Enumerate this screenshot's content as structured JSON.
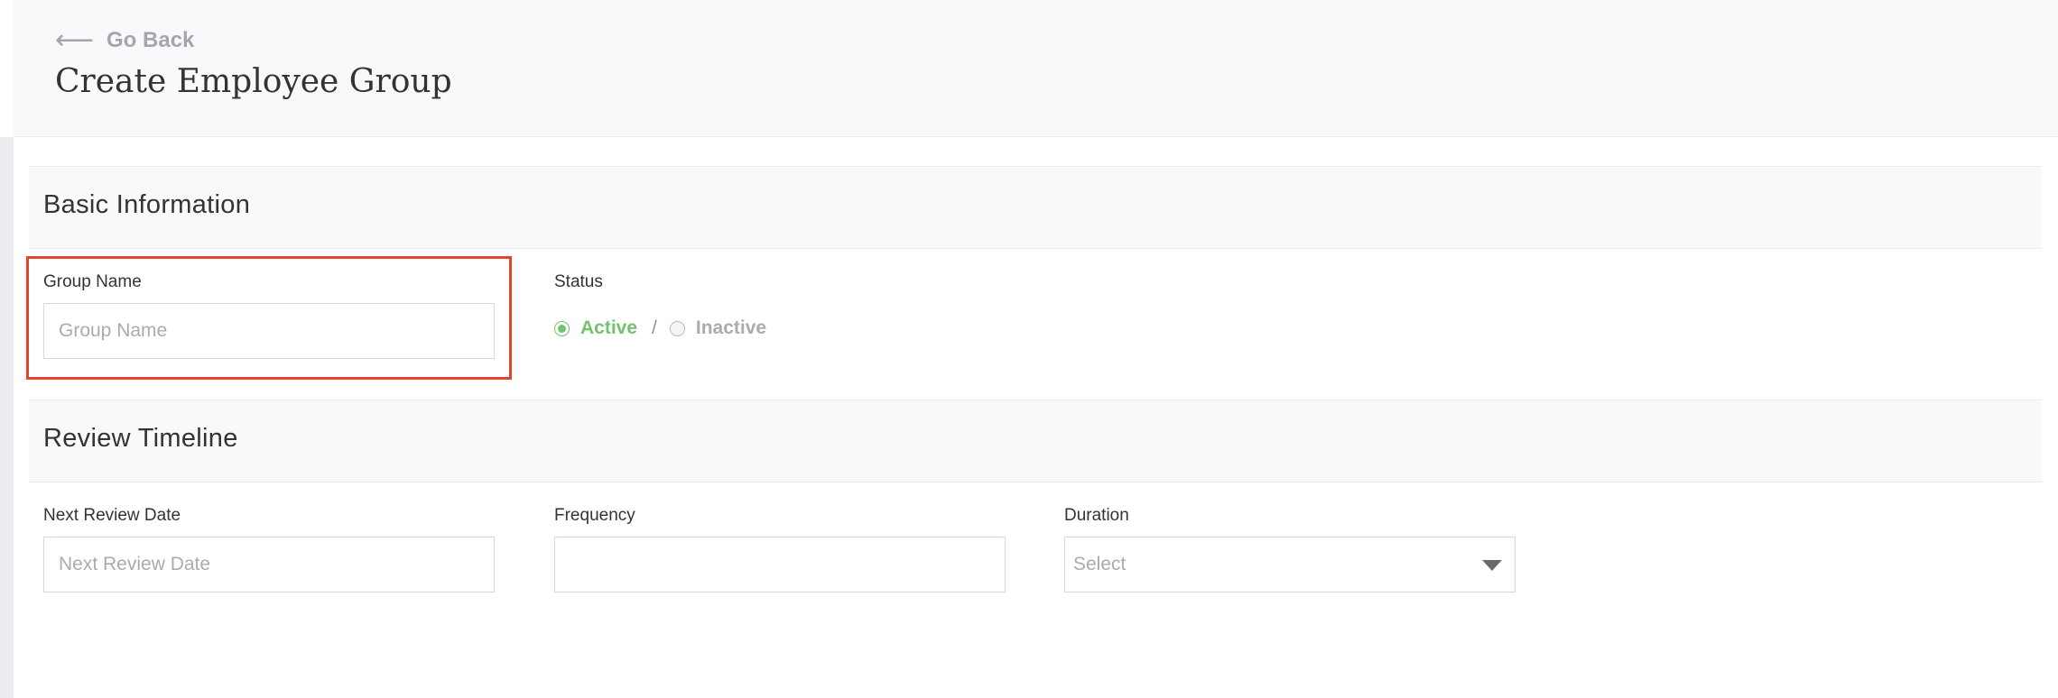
{
  "header": {
    "go_back_label": "Go Back",
    "title": "Create Employee Group"
  },
  "basic_information": {
    "title": "Basic Information",
    "group_name": {
      "label": "Group Name",
      "placeholder": "Group Name",
      "value": ""
    },
    "status": {
      "label": "Status",
      "options": [
        {
          "label": "Active",
          "selected": true
        },
        {
          "label": "Inactive",
          "selected": false
        }
      ],
      "separator": "/"
    }
  },
  "review_timeline": {
    "title": "Review Timeline",
    "next_review_date": {
      "label": "Next Review Date",
      "placeholder": "Next Review Date",
      "value": ""
    },
    "frequency": {
      "label": "Frequency",
      "placeholder": "",
      "value": ""
    },
    "duration": {
      "label": "Duration",
      "selected": "Select"
    }
  },
  "colors": {
    "active_green": "#72c36d",
    "highlight_red": "#e2472b",
    "muted_text": "#a8acb1"
  },
  "icons": {
    "go_back": "arrow-left-icon",
    "duration_caret": "caret-down-icon"
  }
}
